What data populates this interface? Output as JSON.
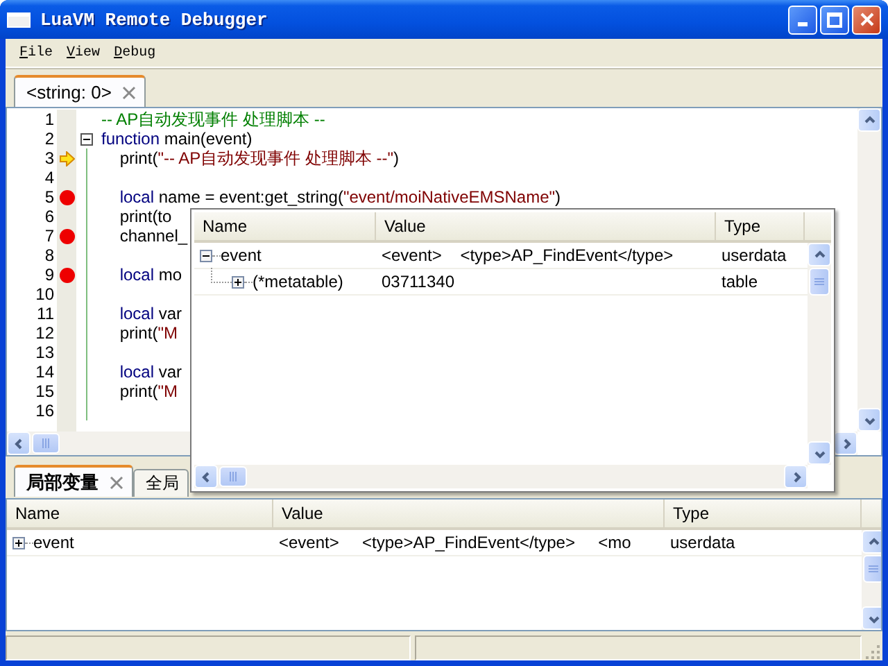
{
  "window": {
    "title": "LuaVM Remote Debugger"
  },
  "menu": [
    "File",
    "View",
    "Debug"
  ],
  "editor_tabs": [
    {
      "label": "<string: 0>",
      "selected": true
    }
  ],
  "code_lines": [
    {
      "number": "1",
      "segments": [
        {
          "kind": "comment",
          "text": "-- AP自动发现事件 处理脚本 --"
        }
      ]
    },
    {
      "number": "2",
      "fold": true,
      "segments": [
        {
          "kind": "keyword",
          "text": "function"
        },
        {
          "kind": "plain",
          "text": " main(event)"
        }
      ]
    },
    {
      "number": "3",
      "current": true,
      "segments": [
        {
          "kind": "plain",
          "text": "\tprint("
        },
        {
          "kind": "string",
          "text": "\"-- AP自动发现事件 处理脚本 --\""
        },
        {
          "kind": "plain",
          "text": ")"
        }
      ]
    },
    {
      "number": "4"
    },
    {
      "number": "5",
      "breakpoint": true,
      "segments": [
        {
          "kind": "keyword",
          "text": "\tlocal"
        },
        {
          "kind": "plain",
          "text": " name = event:get_string("
        },
        {
          "kind": "string",
          "text": "\"event/moiNativeEMSName\""
        },
        {
          "kind": "plain",
          "text": ")"
        }
      ]
    },
    {
      "number": "6",
      "segments": [
        {
          "kind": "plain",
          "text": "\tprint(to"
        }
      ]
    },
    {
      "number": "7",
      "breakpoint": true,
      "segments": [
        {
          "kind": "plain",
          "text": "\tchannel_"
        }
      ]
    },
    {
      "number": "8"
    },
    {
      "number": "9",
      "breakpoint": true,
      "segments": [
        {
          "kind": "keyword",
          "text": "\tlocal"
        },
        {
          "kind": "plain",
          "text": " mo"
        }
      ]
    },
    {
      "number": "10"
    },
    {
      "number": "11",
      "segments": [
        {
          "kind": "keyword",
          "text": "\tlocal"
        },
        {
          "kind": "plain",
          "text": " var"
        }
      ]
    },
    {
      "number": "12",
      "segments": [
        {
          "kind": "plain",
          "text": "\tprint("
        },
        {
          "kind": "string",
          "text": "\"M"
        }
      ]
    },
    {
      "number": "13"
    },
    {
      "number": "14",
      "segments": [
        {
          "kind": "keyword",
          "text": "\tlocal"
        },
        {
          "kind": "plain",
          "text": " var"
        }
      ]
    },
    {
      "number": "15",
      "segments": [
        {
          "kind": "plain",
          "text": "\tprint("
        },
        {
          "kind": "string",
          "text": "\"M"
        }
      ]
    },
    {
      "number": "16"
    }
  ],
  "popup": {
    "columns": [
      "Name",
      "Value",
      "Type"
    ],
    "rows": [
      {
        "name": "event",
        "expanded": true,
        "value": "<event>    <type>AP_FindEvent</type>",
        "type": "userdata",
        "children": [
          {
            "name": "(*metatable)",
            "expanded": false,
            "value": "03711340",
            "type": "table"
          }
        ]
      }
    ]
  },
  "panel_tabs": [
    {
      "label": "局部变量",
      "selected": true
    },
    {
      "label": "全局",
      "selected": false
    }
  ],
  "locals": {
    "columns": [
      "Name",
      "Value",
      "Type"
    ],
    "rows": [
      {
        "name": "event",
        "expanded": false,
        "value": "<event>     <type>AP_FindEvent</type>     <mo",
        "type": "userdata"
      }
    ]
  }
}
